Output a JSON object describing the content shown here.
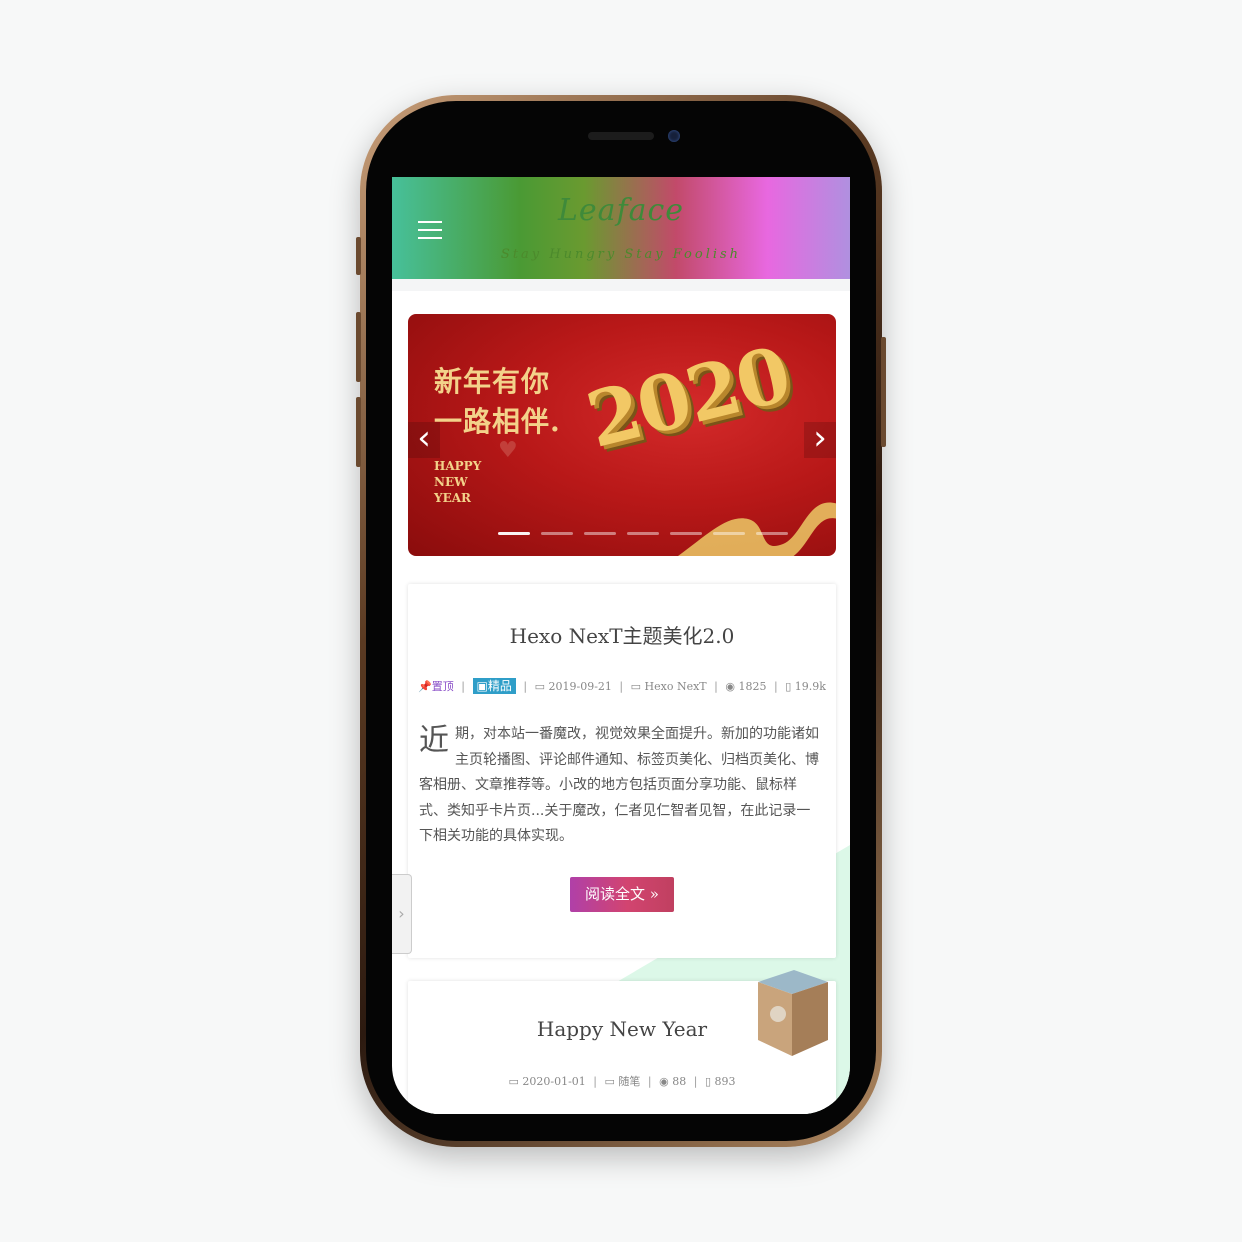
{
  "header": {
    "logo": "Leaface",
    "subtitle": "Stay Hungry Stay Foolish"
  },
  "carousel": {
    "line1": "新年有你",
    "line2": "一路相伴.",
    "happy": [
      "HAPPY",
      "NEW",
      "YEAR"
    ],
    "year": "2020",
    "prev_glyph": "‹",
    "next_glyph": "›",
    "slide_count": 7,
    "active_slide": 0
  },
  "posts": [
    {
      "title": "Hexo NexT主题美化2.0",
      "pinned": "置顶",
      "badge": "精品",
      "date": "2019-09-21",
      "category": "Hexo NexT",
      "views": "1825",
      "words": "19.9k",
      "dropcap": "近",
      "excerpt": "期，对本站一番魔改，视觉效果全面提升。新加的功能诸如主页轮播图、评论邮件通知、标签页美化、归档页美化、博客相册、文章推荐等。小改的地方包括页面分享功能、鼠标样式、类知乎卡片页...关于魔改，仁者见仁智者见智，在此记录一下相关功能的具体实现。",
      "read_more": "阅读全文 »"
    },
    {
      "title": "Happy New Year",
      "date": "2020-01-01",
      "category": "随笔",
      "views": "88",
      "words": "893"
    }
  ],
  "colors": {
    "pin": "#8a4fc8",
    "badge": "#2f9ec8",
    "diagonal": "#dcf8e8"
  }
}
